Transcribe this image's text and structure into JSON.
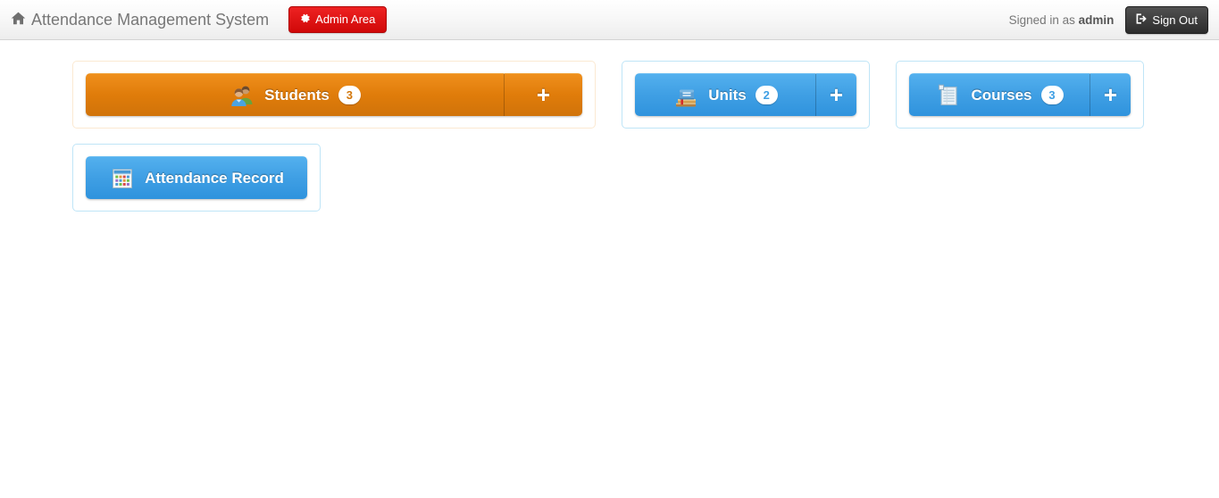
{
  "header": {
    "home_icon": "home-icon",
    "brand_title": "Attendance Management System",
    "admin_button": {
      "icon": "gear-icon",
      "label": "Admin Area",
      "color": "#d00808"
    },
    "signed_in_prefix": "Signed in as",
    "signed_in_user": "admin",
    "signout_button": {
      "icon": "sign-out-icon",
      "label": "Sign Out",
      "color": "#2c2c2c"
    }
  },
  "panels": [
    {
      "key": "students",
      "label": "Students",
      "count": "3",
      "icon": "people-icon",
      "color": "#e07c0a",
      "border_color": "#fbe9d2",
      "add_label": "+",
      "has_add": true
    },
    {
      "key": "units",
      "label": "Units",
      "count": "2",
      "icon": "books-icon",
      "color": "#3f9fe4",
      "border_color": "#bfe5f7",
      "add_label": "+",
      "has_add": true
    },
    {
      "key": "courses",
      "label": "Courses",
      "count": "3",
      "icon": "document-list-icon",
      "color": "#3f9fe4",
      "border_color": "#bfe5f7",
      "add_label": "+",
      "has_add": true
    },
    {
      "key": "attendance_record",
      "label": "Attendance Record",
      "count": "",
      "icon": "calendar-icon",
      "color": "#3f9fe4",
      "border_color": "#bfe5f7",
      "add_label": "",
      "has_add": false
    }
  ]
}
